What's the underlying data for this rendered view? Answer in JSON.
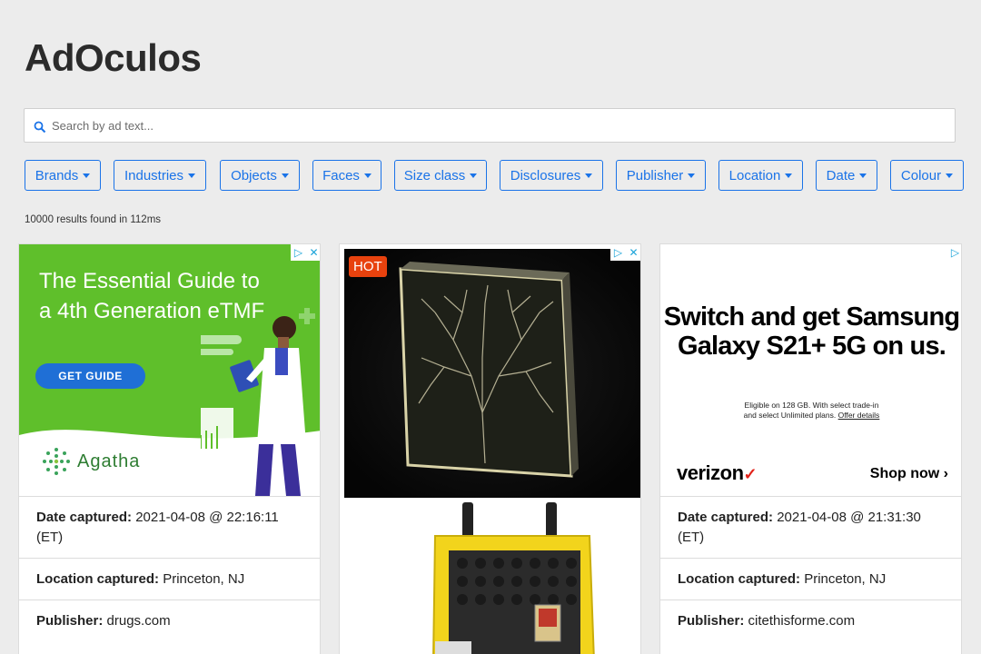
{
  "app": {
    "title": "AdOculos"
  },
  "search": {
    "placeholder": "Search by ad text..."
  },
  "filters": [
    "Brands",
    "Industries",
    "Objects",
    "Faces",
    "Size class",
    "Disclosures",
    "Publisher",
    "Location",
    "Date",
    "Colour"
  ],
  "results_text": "10000 results found in 112ms",
  "colors": {
    "accent": "#1a73e8",
    "background": "#ececec",
    "ad1_green": "#5fbf2b",
    "hot_badge": "#e8420e",
    "verizon_check": "#e2231a"
  },
  "cards": [
    {
      "ad": {
        "headline": "The Essential Guide to a 4th Generation eTMF",
        "cta": "GET GUIDE",
        "brand": "Agatha"
      },
      "date_label": "Date captured:",
      "date_value": "2021-04-08 @ 22:16:11 (ET)",
      "location_label": "Location captured:",
      "location_value": "Princeton, NJ",
      "publisher_label": "Publisher:",
      "publisher_value": "drugs.com"
    },
    {
      "ad": {
        "badge": "HOT"
      }
    },
    {
      "ad": {
        "headline": "Switch and get Samsung Galaxy S21+ 5G on us.",
        "fine_print_1": "Eligible on 128 GB. With select trade-in",
        "fine_print_2": "and select Unlimited plans.",
        "fine_print_link": "Offer details",
        "brand": "verizon",
        "cta": "Shop now"
      },
      "date_label": "Date captured:",
      "date_value": "2021-04-08 @ 21:31:30 (ET)",
      "location_label": "Location captured:",
      "location_value": "Princeton, NJ",
      "publisher_label": "Publisher:",
      "publisher_value": "citethisforme.com"
    }
  ]
}
